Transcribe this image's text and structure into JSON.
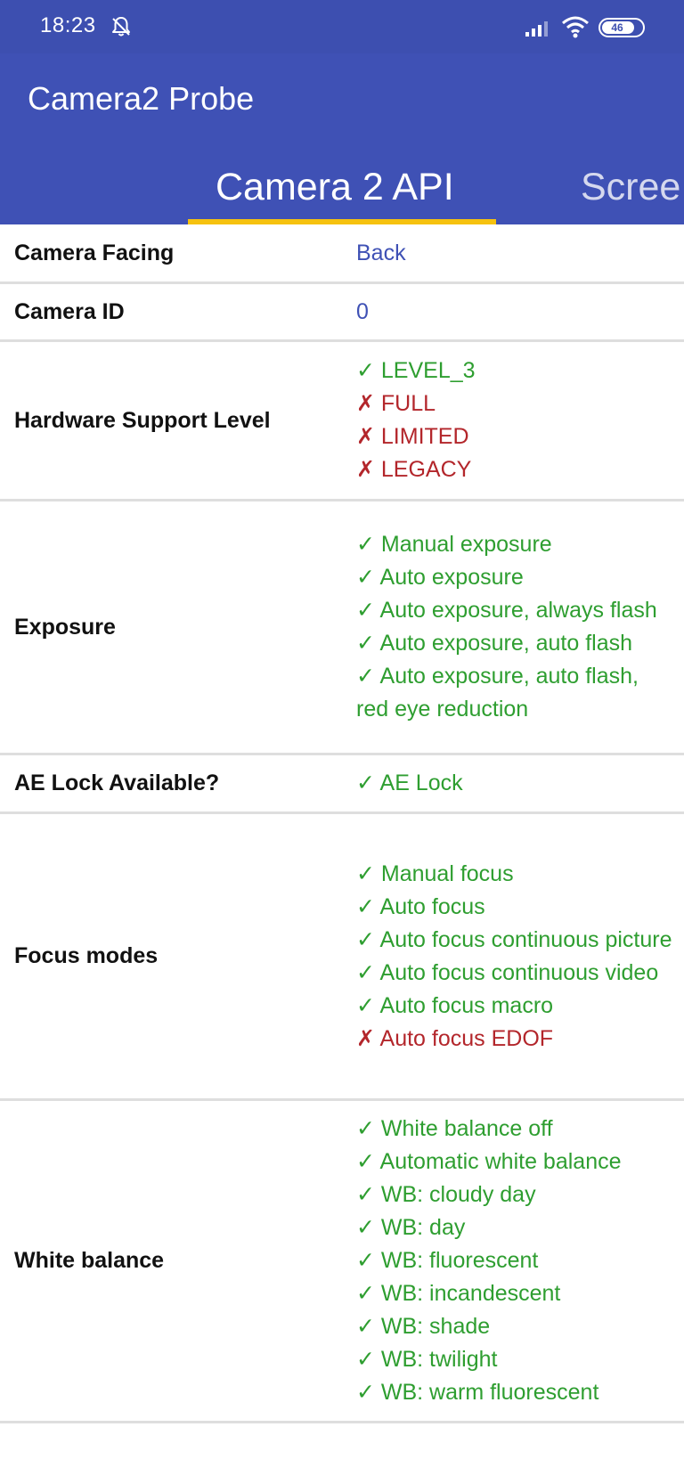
{
  "status_bar": {
    "time": "18:23",
    "battery_level": "46"
  },
  "app_bar": {
    "title": "Camera2 Probe"
  },
  "tabs": [
    {
      "label": "Camera 2 API",
      "selected": true
    },
    {
      "label": "Scree",
      "selected": false
    }
  ],
  "colors": {
    "primary": "#3f51b5",
    "status_bar": "#3d4fb0",
    "tab_indicator": "#f6c20f",
    "supported": "#2e9e30",
    "unsupported": "#b3262b"
  },
  "rows": [
    {
      "label": "Camera Facing",
      "values": [
        {
          "text": "Back",
          "status": "plain"
        }
      ]
    },
    {
      "label": "Camera ID",
      "values": [
        {
          "text": "0",
          "status": "plain"
        }
      ]
    },
    {
      "label": "Hardware Support Level",
      "values": [
        {
          "text": "✓ LEVEL_3",
          "status": "ok"
        },
        {
          "text": "✗ FULL",
          "status": "bad"
        },
        {
          "text": "✗ LIMITED",
          "status": "bad"
        },
        {
          "text": "✗ LEGACY",
          "status": "bad"
        }
      ]
    },
    {
      "label": "Exposure",
      "values": [
        {
          "text": "✓ Manual exposure",
          "status": "ok"
        },
        {
          "text": "✓ Auto exposure",
          "status": "ok"
        },
        {
          "text": "✓ Auto exposure, always flash",
          "status": "ok"
        },
        {
          "text": "✓ Auto exposure, auto flash",
          "status": "ok"
        },
        {
          "text": "✓ Auto exposure, auto flash, red eye reduction",
          "status": "ok"
        }
      ]
    },
    {
      "label": "AE Lock Available?",
      "values": [
        {
          "text": "✓ AE Lock",
          "status": "ok"
        }
      ]
    },
    {
      "label": "Focus modes",
      "values": [
        {
          "text": "✓ Manual focus",
          "status": "ok"
        },
        {
          "text": "✓ Auto focus",
          "status": "ok"
        },
        {
          "text": "✓ Auto focus continuous picture",
          "status": "ok"
        },
        {
          "text": "✓ Auto focus continuous video",
          "status": "ok"
        },
        {
          "text": "✓ Auto focus macro",
          "status": "ok"
        },
        {
          "text": "✗ Auto focus EDOF",
          "status": "bad"
        }
      ]
    },
    {
      "label": "White balance",
      "values": [
        {
          "text": "✓ White balance off",
          "status": "ok"
        },
        {
          "text": "✓ Automatic white balance",
          "status": "ok"
        },
        {
          "text": "✓ WB: cloudy day",
          "status": "ok"
        },
        {
          "text": "✓ WB: day",
          "status": "ok"
        },
        {
          "text": "✓ WB: fluorescent",
          "status": "ok"
        },
        {
          "text": "✓ WB: incandescent",
          "status": "ok"
        },
        {
          "text": "✓ WB: shade",
          "status": "ok"
        },
        {
          "text": "✓ WB: twilight",
          "status": "ok"
        },
        {
          "text": "✓ WB: warm fluorescent",
          "status": "ok"
        }
      ]
    }
  ]
}
